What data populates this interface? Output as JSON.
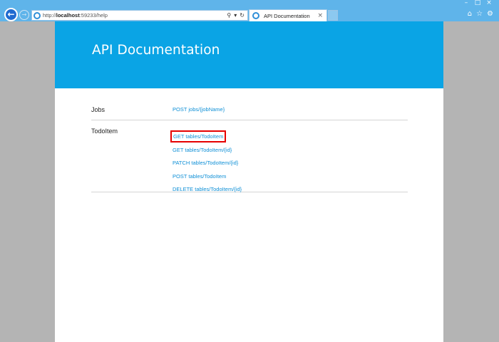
{
  "browser": {
    "url_prefix": "http://",
    "url_host": "localhost",
    "url_rest": ":59233/help",
    "tab_title": "API Documentation",
    "tab_close": "×",
    "window": {
      "minimize": "–",
      "maximize": "□",
      "close": "×"
    }
  },
  "page": {
    "title": "API Documentation",
    "groups": [
      {
        "name": "Jobs",
        "links": [
          "POST jobs/{jobName}"
        ]
      },
      {
        "name": "TodoItem",
        "links": [
          "GET tables/TodoItem",
          "GET tables/TodoItem/{id}",
          "PATCH tables/TodoItem/{id}",
          "POST tables/TodoItem",
          "DELETE tables/TodoItem/{id}"
        ]
      }
    ]
  },
  "colors": {
    "chrome": "#5fb4ea",
    "hero": "#0aa4e5",
    "link": "#0d8fd6",
    "highlight": "#e60000"
  }
}
